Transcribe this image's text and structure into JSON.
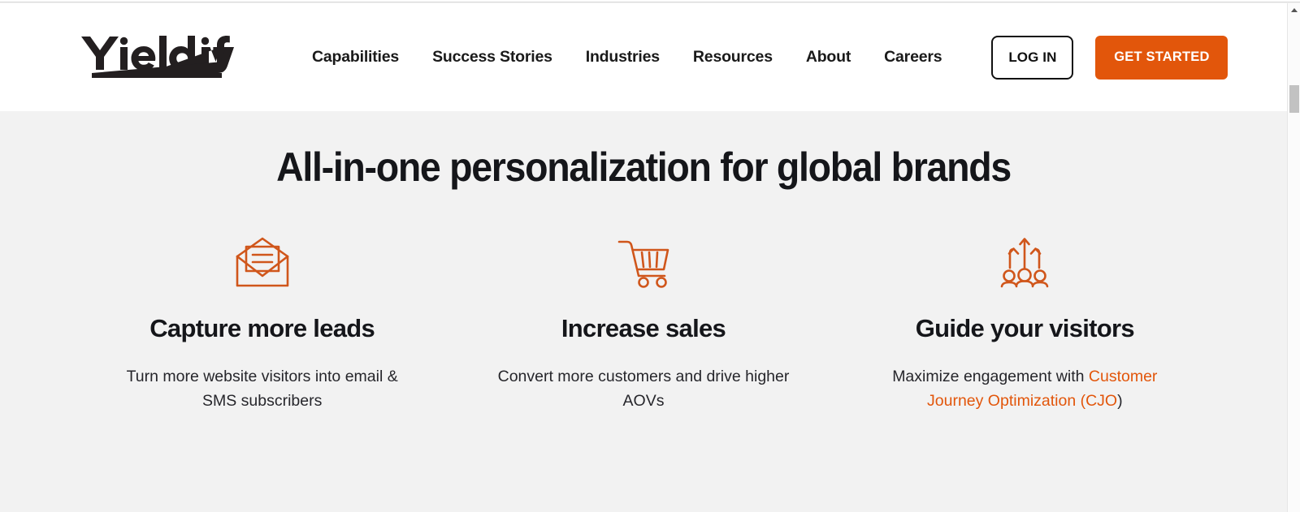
{
  "brand": {
    "logo_text": "Yieldify",
    "accent_color": "#e2560b",
    "text_color": "#15161a",
    "header_bg": "#ffffff",
    "page_bg": "#f2f2f2"
  },
  "header": {
    "nav_items": [
      {
        "label": "Capabilities"
      },
      {
        "label": "Success Stories"
      },
      {
        "label": "Industries"
      },
      {
        "label": "Resources"
      },
      {
        "label": "About"
      },
      {
        "label": "Careers"
      }
    ],
    "login_label": "LOG IN",
    "get_started_label": "GET STARTED"
  },
  "main": {
    "title": "All-in-one personalization for global brands",
    "cards": [
      {
        "icon": "open-envelope-icon",
        "title": "Capture more leads",
        "text": "Turn more website visitors into email & SMS subscribers",
        "link_text": "",
        "text_after_link": ""
      },
      {
        "icon": "shopping-cart-icon",
        "title": "Increase sales",
        "text": "Convert more customers and drive higher AOVs",
        "link_text": "",
        "text_after_link": ""
      },
      {
        "icon": "audience-growth-icon",
        "title": "Guide your visitors",
        "text": "Maximize engagement with ",
        "link_text": "Customer Journey Optimization (CJO",
        "text_after_link": ")"
      }
    ]
  },
  "scrollbar": {
    "orientation": "vertical",
    "thumb_position_pct": 16
  }
}
